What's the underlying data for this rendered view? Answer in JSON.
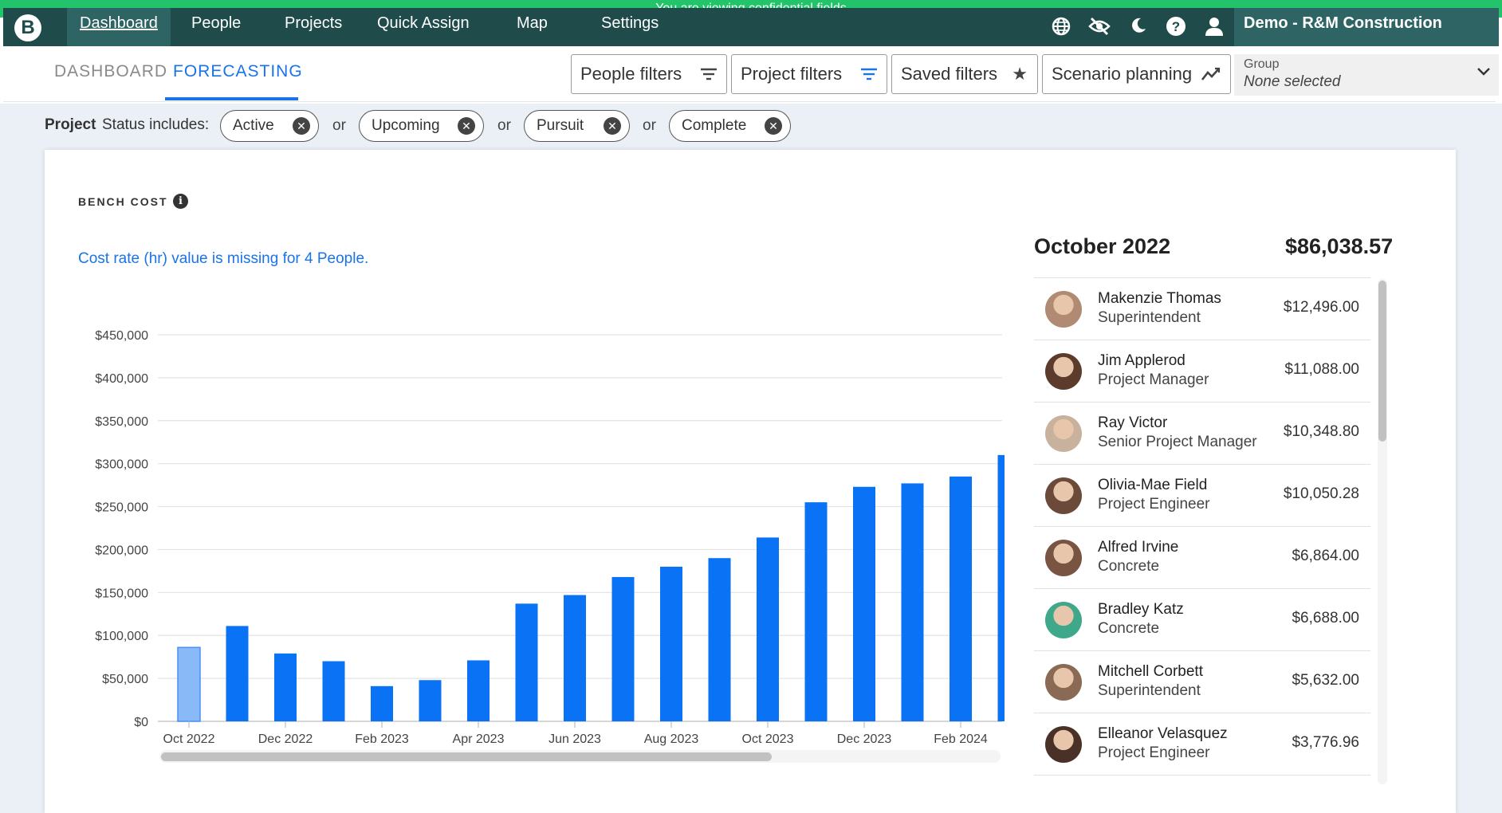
{
  "banner": "You are viewing confidential fields",
  "nav": {
    "items": [
      "Dashboard",
      "People",
      "Projects",
      "Quick Assign",
      "Map",
      "Settings"
    ],
    "active": "Dashboard",
    "company": "Demo - R&M Construction",
    "icons": [
      "globe-icon",
      "eye-off-icon",
      "moon-icon",
      "help-icon",
      "user-icon"
    ]
  },
  "subheader": {
    "tabs": [
      "DASHBOARD",
      "FORECASTING"
    ],
    "active_tab": "FORECASTING",
    "filters": {
      "people": "People filters",
      "project": "Project filters",
      "saved": "Saved filters",
      "scenario": "Scenario planning"
    },
    "group": {
      "label": "Group",
      "value": "None selected"
    }
  },
  "status_filter": {
    "title": "Project",
    "label": "Status includes:",
    "chips": [
      "Active",
      "Upcoming",
      "Pursuit",
      "Complete"
    ],
    "separator": "or"
  },
  "card": {
    "title": "BENCH COST",
    "missing_note": "Cost rate (hr) value is missing for 4 People."
  },
  "chart_data": {
    "type": "bar",
    "categories": [
      "Oct 2022",
      "Nov 2022",
      "Dec 2022",
      "Jan 2023",
      "Feb 2023",
      "Mar 2023",
      "Apr 2023",
      "May 2023",
      "Jun 2023",
      "Jul 2023",
      "Aug 2023",
      "Sep 2023",
      "Oct 2023",
      "Nov 2023",
      "Dec 2023",
      "Jan 2024",
      "Feb 2024",
      "Mar 2024"
    ],
    "x_tick_labels": [
      "Oct 2022",
      "Dec 2022",
      "Feb 2023",
      "Apr 2023",
      "Jun 2023",
      "Aug 2023",
      "Oct 2023",
      "Dec 2023",
      "Feb 2024"
    ],
    "values": [
      86038.57,
      111000,
      79000,
      70000,
      41000,
      48000,
      71000,
      137000,
      147000,
      168000,
      180000,
      190000,
      214000,
      255000,
      273000,
      277000,
      285000,
      310000
    ],
    "selected_index": 0,
    "y_tick_labels": [
      "$0",
      "$50,000",
      "$100,000",
      "$150,000",
      "$200,000",
      "$250,000",
      "$300,000",
      "$350,000",
      "$400,000",
      "$450,000"
    ],
    "ylim": [
      0,
      450000
    ],
    "grid": true,
    "colors": {
      "bar": "#0a72f5",
      "selected": "#8ab9f8",
      "grid": "#e3e3e3"
    }
  },
  "detail": {
    "month": "October 2022",
    "total": "$86,038.57",
    "people": [
      {
        "name": "Makenzie Thomas",
        "role": "Superintendent",
        "amount": "$12,496.00",
        "avatar_color": "#b08a72"
      },
      {
        "name": "Jim Applerod",
        "role": "Project Manager",
        "amount": "$11,088.00",
        "avatar_color": "#5c3b2c"
      },
      {
        "name": "Ray Victor",
        "role": "Senior Project Manager",
        "amount": "$10,348.80",
        "avatar_color": "#c9b29d"
      },
      {
        "name": "Olivia-Mae Field",
        "role": "Project Engineer",
        "amount": "$10,050.28",
        "avatar_color": "#6b4a3a"
      },
      {
        "name": "Alfred Irvine",
        "role": "Concrete",
        "amount": "$6,864.00",
        "avatar_color": "#7a5442"
      },
      {
        "name": "Bradley Katz",
        "role": "Concrete",
        "amount": "$6,688.00",
        "avatar_color": "#3fa88a"
      },
      {
        "name": "Mitchell Corbett",
        "role": "Superintendent",
        "amount": "$5,632.00",
        "avatar_color": "#8a6a55"
      },
      {
        "name": "Elleanor Velasquez",
        "role": "Project Engineer",
        "amount": "$3,776.96",
        "avatar_color": "#4a3128"
      }
    ]
  }
}
